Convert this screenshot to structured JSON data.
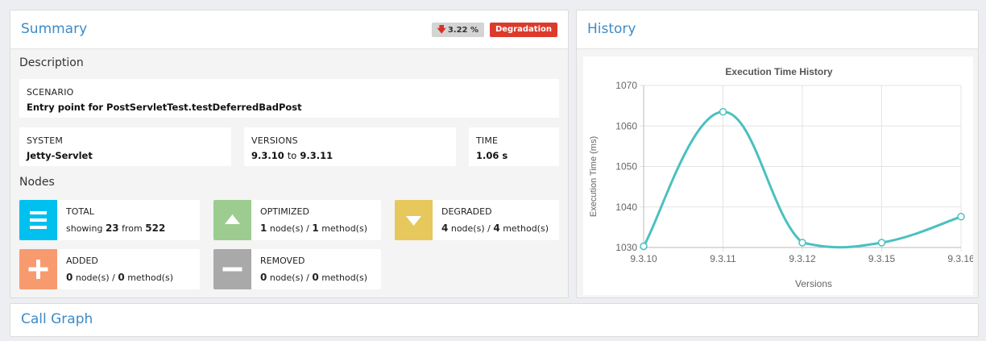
{
  "summary": {
    "title": "Summary",
    "change_arrow_icon": "down-arrow-icon",
    "change_pct": "3.22 %",
    "status_badge": "Degradation",
    "description_label": "Description",
    "scenario": {
      "label": "SCENARIO",
      "value": "Entry point for PostServletTest.testDeferredBadPost"
    },
    "system": {
      "label": "SYSTEM",
      "value": "Jetty-Servlet"
    },
    "versions": {
      "label": "VERSIONS",
      "from": "9.3.10",
      "to_word": "to",
      "to": "9.3.11"
    },
    "time": {
      "label": "TIME",
      "value": "1.06 s"
    },
    "nodes_label": "Nodes",
    "nodes": {
      "total": {
        "label": "TOTAL",
        "prefix": "showing",
        "count": "23",
        "mid": "from",
        "of": "522",
        "icon": "list-icon",
        "color": "#00c0ef"
      },
      "optimized": {
        "label": "OPTIMIZED",
        "nodes": "1",
        "nodes_unit": "node(s)",
        "sep": "/",
        "methods": "1",
        "methods_unit": "method(s)",
        "icon": "triangle-up-icon",
        "color": "#9ccc8f"
      },
      "degraded": {
        "label": "DEGRADED",
        "nodes": "4",
        "nodes_unit": "node(s)",
        "sep": "/",
        "methods": "4",
        "methods_unit": "method(s)",
        "icon": "triangle-down-icon",
        "color": "#e6c85c"
      },
      "added": {
        "label": "ADDED",
        "nodes": "0",
        "nodes_unit": "node(s)",
        "sep": "/",
        "methods": "0",
        "methods_unit": "method(s)",
        "icon": "plus-icon",
        "color": "#f79a6e"
      },
      "removed": {
        "label": "REMOVED",
        "nodes": "0",
        "nodes_unit": "node(s)",
        "sep": "/",
        "methods": "0",
        "methods_unit": "method(s)",
        "icon": "minus-icon",
        "color": "#a9a9a9"
      }
    }
  },
  "history": {
    "title": "History"
  },
  "call_graph": {
    "title": "Call Graph"
  },
  "chart_data": {
    "type": "line",
    "title": "Execution Time History",
    "xlabel": "Versions",
    "ylabel": "Execution Time (ms)",
    "categories": [
      "9.3.10",
      "9.3.11",
      "9.3.12",
      "9.3.15",
      "9.3.16"
    ],
    "values": [
      1030.3,
      1063.5,
      1031.2,
      1031.2,
      1037.6
    ],
    "ylim": [
      1030,
      1070
    ],
    "yticks": [
      "1030",
      "1040",
      "1050",
      "1060",
      "1070"
    ],
    "grid": true,
    "legend": "none",
    "line_color": "#4bc0c0"
  }
}
